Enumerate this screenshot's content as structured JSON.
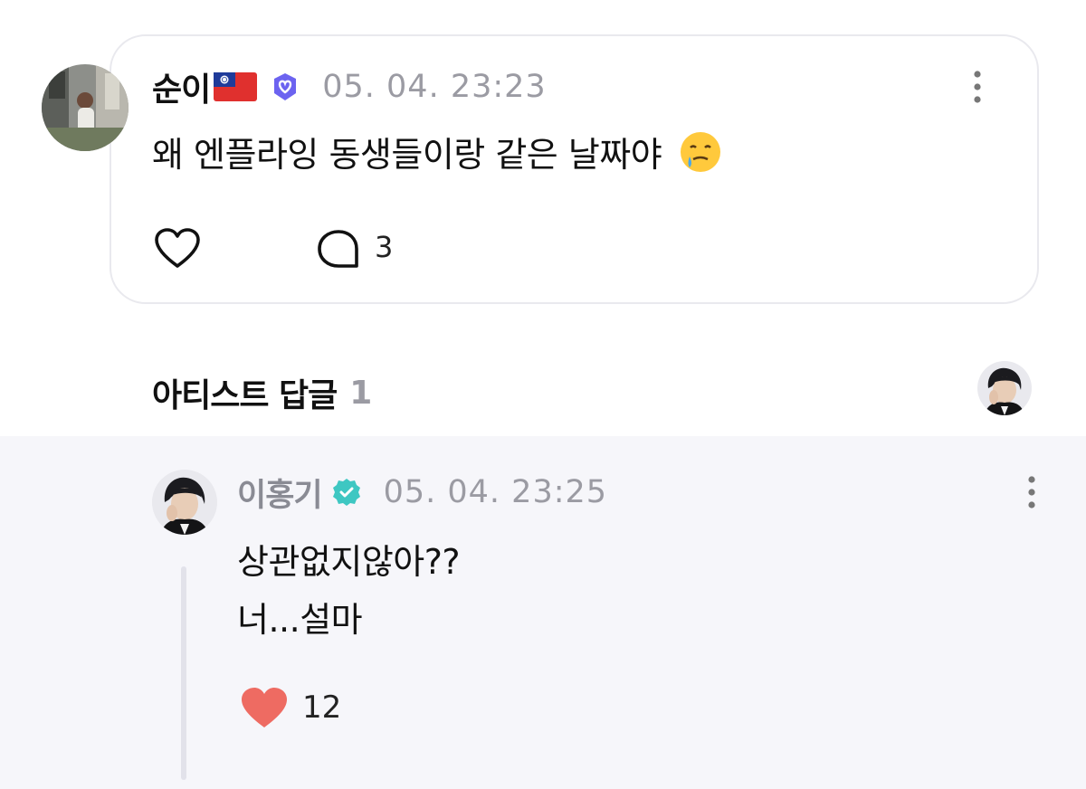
{
  "post": {
    "author": "순이",
    "flag_icon": "taiwan-flag-icon",
    "badge_icon": "fan-verified-badge-icon",
    "timestamp": "05. 04. 23:23",
    "text": "왜 엔플라잉 동생들이랑 같은 날짜야",
    "emoji_icon": "face-holding-back-tears-icon",
    "like_icon": "heart-outline-icon",
    "comment_icon": "comment-bubble-icon",
    "comment_count": "3"
  },
  "artist_replies": {
    "title": "아티스트 답글",
    "count": "1"
  },
  "reply": {
    "author": "이홍기",
    "badge_icon": "artist-verified-badge-icon",
    "timestamp": "05. 04. 23:25",
    "lines": [
      "상관없지않아??",
      "너...설마"
    ],
    "like_icon": "heart-filled-icon",
    "like_count": "12"
  },
  "colors": {
    "accent_badge": "#6c63f0",
    "artist_badge": "#3ec7c2",
    "like_red": "#ee6b62",
    "muted": "#9b9ba3",
    "reply_bg": "#f6f6fa"
  }
}
